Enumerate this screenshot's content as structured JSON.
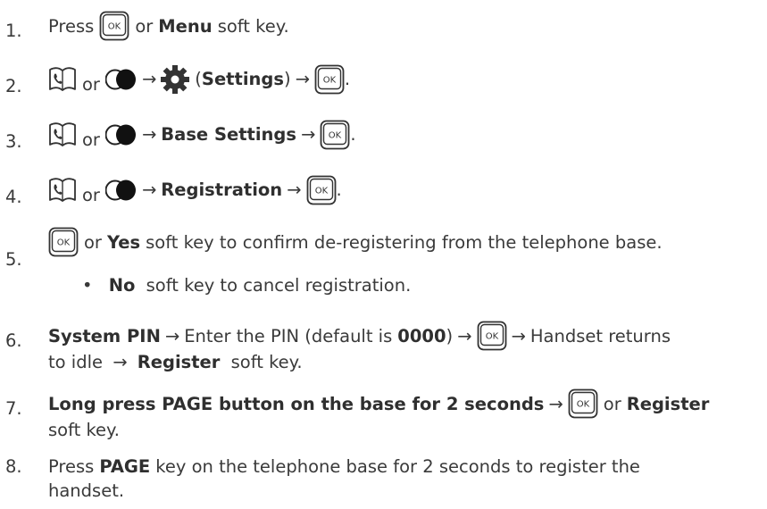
{
  "steps": [
    {
      "n": "1.",
      "a": "Press",
      "b": "or",
      "c": "Menu",
      "d": "soft key."
    },
    {
      "n": "2.",
      "or": "or",
      "arrow1": "→",
      "settings_open": "(",
      "settings": "Settings",
      "settings_close": ")",
      "arrow2": "→",
      "end": "."
    },
    {
      "n": "3.",
      "or": "or",
      "arrow1": "→",
      "label": "Base Settings",
      "arrow2": "→",
      "end": "."
    },
    {
      "n": "4.",
      "or": "or",
      "arrow1": "→",
      "label": "Registration",
      "arrow2": "→",
      "end": "."
    },
    {
      "n": "5.",
      "or": "or",
      "yes": "Yes",
      "rest": "soft key to confirm de-registering from the telephone base."
    },
    {
      "bullet": "•",
      "no": "No",
      "rest": "soft key to cancel registration."
    },
    {
      "n": "6.",
      "pin": "System PIN",
      "arrow1": "→",
      "a": "Enter the PIN (default is",
      "code": "0000",
      "b": ")",
      "arrow2": "→",
      "arrow3": "→",
      "c": "Handset returns",
      "line2a": "to idle",
      "arrow4": "→",
      "register": "Register",
      "line2b": "soft key."
    },
    {
      "n": "7.",
      "bold": "Long press PAGE button on the base for 2 seconds",
      "arrow1": "→",
      "or": "or",
      "register": "Register",
      "line2": "soft key."
    },
    {
      "n": "8.",
      "a": "Press",
      "page": "PAGE",
      "b": "key on the telephone base for 2 seconds to register the",
      "line2": "handset."
    }
  ],
  "icons": {
    "ok_key_label": "OK",
    "phonebook": "phonebook-icon",
    "nav": "nav-key-icon",
    "settings": "settings-gear-icon"
  }
}
